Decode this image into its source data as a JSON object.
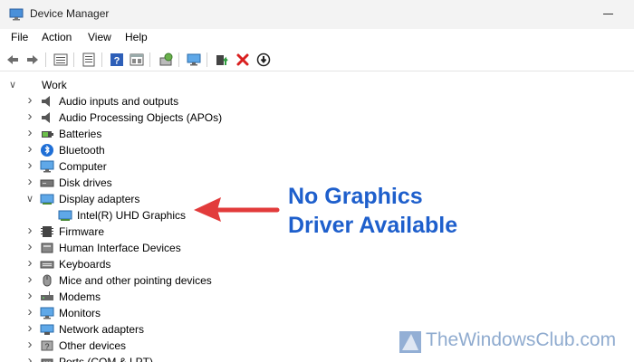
{
  "window": {
    "title": "Device Manager"
  },
  "menu": [
    "File",
    "Action",
    "View",
    "Help"
  ],
  "toolbar": {
    "buttons": [
      "back-icon",
      "forward-icon",
      "properties-icon",
      "list-icon",
      "help-icon",
      "view-icon",
      "scan-icon",
      "monitor-icon",
      "update-driver-icon",
      "uninstall-icon",
      "disable-icon"
    ]
  },
  "tree": {
    "root": "Work",
    "items": [
      {
        "label": "Audio inputs and outputs",
        "icon": "speaker-icon",
        "expander": ">"
      },
      {
        "label": "Audio Processing Objects (APOs)",
        "icon": "speaker-icon",
        "expander": ">"
      },
      {
        "label": "Batteries",
        "icon": "battery-icon",
        "expander": ">"
      },
      {
        "label": "Bluetooth",
        "icon": "bluetooth-icon",
        "expander": ">"
      },
      {
        "label": "Computer",
        "icon": "computer-icon",
        "expander": ">"
      },
      {
        "label": "Disk drives",
        "icon": "disk-icon",
        "expander": ">"
      },
      {
        "label": "Display adapters",
        "icon": "display-adapter-icon",
        "expander": "v"
      },
      {
        "label": "Intel(R) UHD Graphics",
        "icon": "display-adapter-icon",
        "expander": ""
      },
      {
        "label": "Firmware",
        "icon": "firmware-icon",
        "expander": ">"
      },
      {
        "label": "Human Interface Devices",
        "icon": "hid-icon",
        "expander": ">"
      },
      {
        "label": "Keyboards",
        "icon": "keyboard-icon",
        "expander": ">"
      },
      {
        "label": "Mice and other pointing devices",
        "icon": "mouse-icon",
        "expander": ">"
      },
      {
        "label": "Modems",
        "icon": "modem-icon",
        "expander": ">"
      },
      {
        "label": "Monitors",
        "icon": "monitor-icon",
        "expander": ">"
      },
      {
        "label": "Network adapters",
        "icon": "network-icon",
        "expander": ">"
      },
      {
        "label": "Other devices",
        "icon": "other-device-icon",
        "expander": ">"
      },
      {
        "label": "Ports (COM & LPT)",
        "icon": "port-icon",
        "expander": ">"
      }
    ]
  },
  "annotation": {
    "line1": "No Graphics",
    "line2": "Driver Available",
    "color": "#1e5fcc",
    "arrow_color": "#e23b3b"
  },
  "watermark": {
    "text": "TheWindowsClub.com"
  }
}
